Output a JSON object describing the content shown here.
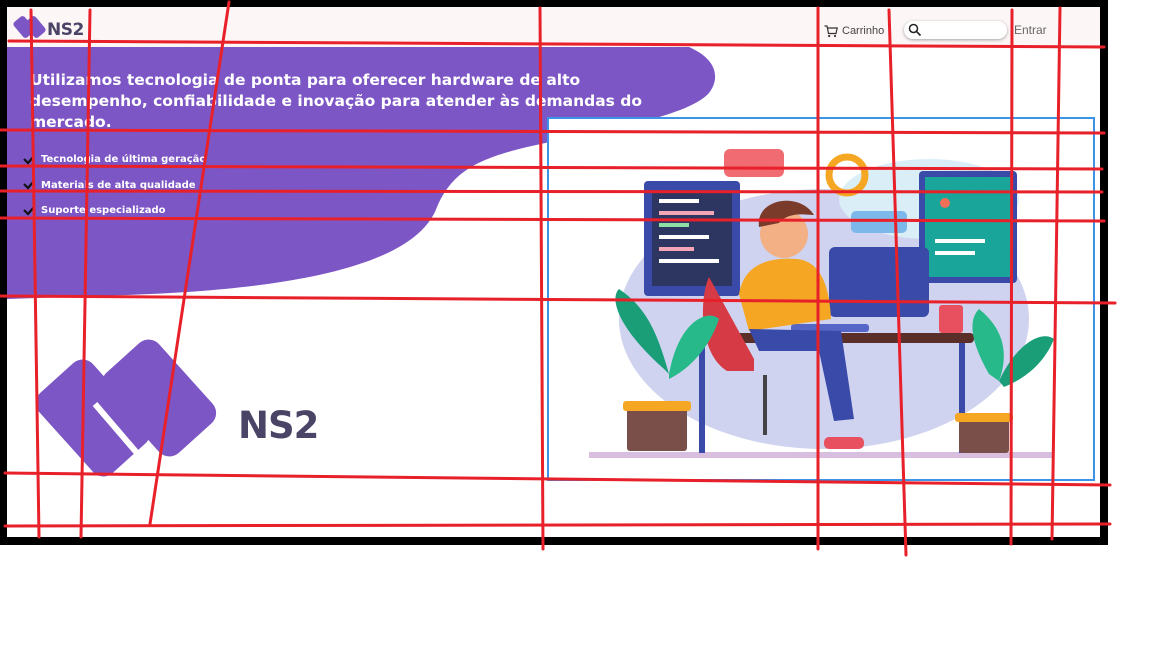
{
  "header": {
    "brand": "NS2",
    "cart_label": "Carrinho",
    "search_placeholder": "",
    "login_label": "Entrar"
  },
  "hero": {
    "headline": "Utilizamos tecnologia de ponta para oferecer hardware de alto desempenho, confiabilidade e inovação para atender às demandas do mercado.",
    "features": [
      {
        "label": "Tecnologia de última geração"
      },
      {
        "label": "Materiais de alta qualidade"
      },
      {
        "label": "Suporte especializado"
      }
    ]
  },
  "brand_block": {
    "name": "NS2"
  },
  "colors": {
    "accent": "#7d56c6",
    "header_bg": "#fdf6f6",
    "brand_text": "#4a4466",
    "illustration_border": "#3d93e8",
    "annotation_red": "#e8202a"
  },
  "icons": {
    "cart": "cart-icon",
    "search": "search-icon",
    "check": "check-icon",
    "logo": "ns2-logo-icon"
  }
}
